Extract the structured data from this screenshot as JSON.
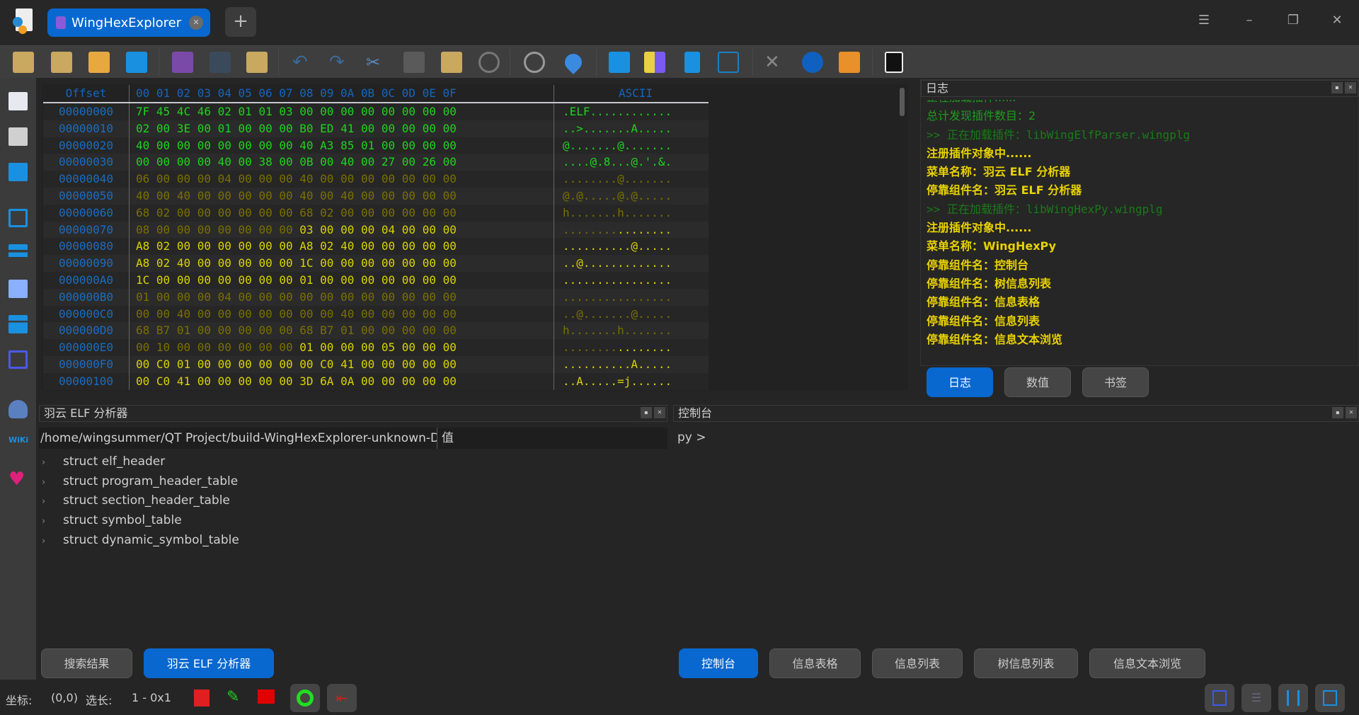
{
  "window": {
    "tab_title": "WingHexExplorer",
    "new_tab": "+",
    "menu_icon": "☰",
    "minimize": "–",
    "restore": "❐",
    "close": "✕"
  },
  "hex": {
    "header": {
      "offset": "Offset",
      "columns": "00 01 02 03 04 05 06 07 08 09 0A 0B 0C 0D 0E 0F",
      "ascii": "ASCII"
    },
    "rows": [
      {
        "offset": "00000000",
        "bytes": "7F 45 4C 46 02 01 01 03 00 00 00 00 00 00 00 00",
        "ascii": ".ELF............",
        "colors": [
          "green",
          "green"
        ]
      },
      {
        "offset": "00000010",
        "bytes": "02 00 3E 00 01 00 00 00 B0 ED 41 00 00 00 00 00",
        "ascii": "..>.......A.....",
        "colors": [
          "green",
          "green"
        ]
      },
      {
        "offset": "00000020",
        "bytes": "40 00 00 00 00 00 00 00 40 A3 85 01 00 00 00 00",
        "ascii": "@.......@.......",
        "colors": [
          "green",
          "green"
        ]
      },
      {
        "offset": "00000030",
        "bytes": "00 00 00 00 40 00 38 00 0B 00 40 00 27 00 26 00",
        "ascii": "....@.8...@.'.&.",
        "colors": [
          "green",
          "green"
        ]
      },
      {
        "offset": "00000040",
        "bytes": "06 00 00 00 04 00 00 00 40 00 00 00 00 00 00 00",
        "ascii": "........@.......",
        "colors": [
          "dim",
          "dim"
        ]
      },
      {
        "offset": "00000050",
        "bytes": "40 00 40 00 00 00 00 00 40 00 40 00 00 00 00 00",
        "ascii": "@.@.....@.@.....",
        "colors": [
          "dim",
          "dim"
        ]
      },
      {
        "offset": "00000060",
        "bytes": "68 02 00 00 00 00 00 00 68 02 00 00 00 00 00 00",
        "ascii": "h.......h.......",
        "colors": [
          "dim",
          "dim"
        ]
      },
      {
        "offset": "00000070",
        "bytes": "08 00 00 00 00 00 00 00 03 00 00 00 04 00 00 00",
        "ascii": "................",
        "colors": [
          "dim",
          "yellow"
        ]
      },
      {
        "offset": "00000080",
        "bytes": "A8 02 00 00 00 00 00 00 A8 02 40 00 00 00 00 00",
        "ascii": "..........@.....",
        "colors": [
          "yellow",
          "yellow"
        ]
      },
      {
        "offset": "00000090",
        "bytes": "A8 02 40 00 00 00 00 00 1C 00 00 00 00 00 00 00",
        "ascii": "..@.............",
        "colors": [
          "yellow",
          "yellow"
        ]
      },
      {
        "offset": "000000A0",
        "bytes": "1C 00 00 00 00 00 00 00 01 00 00 00 00 00 00 00",
        "ascii": "................",
        "colors": [
          "yellow",
          "yellow"
        ]
      },
      {
        "offset": "000000B0",
        "bytes": "01 00 00 00 04 00 00 00 00 00 00 00 00 00 00 00",
        "ascii": "................",
        "colors": [
          "dim",
          "dim"
        ]
      },
      {
        "offset": "000000C0",
        "bytes": "00 00 40 00 00 00 00 00 00 00 40 00 00 00 00 00",
        "ascii": "..@.......@.....",
        "colors": [
          "dim",
          "dim"
        ]
      },
      {
        "offset": "000000D0",
        "bytes": "68 B7 01 00 00 00 00 00 68 B7 01 00 00 00 00 00",
        "ascii": "h.......h.......",
        "colors": [
          "dim",
          "dim"
        ]
      },
      {
        "offset": "000000E0",
        "bytes": "00 10 00 00 00 00 00 00 01 00 00 00 05 00 00 00",
        "ascii": "................",
        "colors": [
          "dim",
          "yellow"
        ]
      },
      {
        "offset": "000000F0",
        "bytes": "00 C0 01 00 00 00 00 00 00 C0 41 00 00 00 00 00",
        "ascii": "..........A.....",
        "colors": [
          "yellow",
          "yellow"
        ]
      },
      {
        "offset": "00000100",
        "bytes": "00 C0 41 00 00 00 00 00 3D 6A 0A 00 00 00 00 00",
        "ascii": "..A.....=j......",
        "colors": [
          "yellow",
          "yellow"
        ]
      }
    ]
  },
  "log": {
    "title": "日志",
    "lines": [
      {
        "text": "正在加载插件......",
        "style": "lg1"
      },
      {
        "text": "总计发现插件数目：2",
        "style": "lg1"
      },
      {
        "text": ">> 正在加载插件：libWingElfParser.wingplg",
        "style": "lg2"
      },
      {
        "text": "注册插件对象中......",
        "style": "lgy"
      },
      {
        "text": "菜单名称：羽云 ELF 分析器",
        "style": "lgy"
      },
      {
        "text": "停靠组件名：羽云 ELF 分析器",
        "style": "lgy"
      },
      {
        "text": ">> 正在加载插件：libWingHexPy.wingplg",
        "style": "lg2"
      },
      {
        "text": "注册插件对象中......",
        "style": "lgy"
      },
      {
        "text": "菜单名称：WingHexPy",
        "style": "lgy"
      },
      {
        "text": "停靠组件名：控制台",
        "style": "lgy"
      },
      {
        "text": "停靠组件名：树信息列表",
        "style": "lgy"
      },
      {
        "text": "停靠组件名：信息表格",
        "style": "lgy"
      },
      {
        "text": "停靠组件名：信息列表",
        "style": "lgy"
      },
      {
        "text": "停靠组件名：信息文本浏览",
        "style": "lgy"
      }
    ],
    "tabs": [
      "日志",
      "数值",
      "书签"
    ]
  },
  "elf": {
    "title": "羽云 ELF 分析器",
    "header": {
      "path": "/home/wingsummer/QT Project/build-WingHexExplorer-unknown-Debug",
      "value": "值"
    },
    "items": [
      "struct elf_header",
      "struct program_header_table",
      "struct section_header_table",
      "struct symbol_table",
      "struct dynamic_symbol_table"
    ]
  },
  "console": {
    "title": "控制台",
    "prompt": "py >"
  },
  "bottom_tabs_left": [
    "搜索结果",
    "羽云 ELF 分析器"
  ],
  "bottom_tabs_right": [
    "控制台",
    "信息表格",
    "信息列表",
    "树信息列表",
    "信息文本浏览"
  ],
  "status": {
    "coord_label": "坐标:",
    "coord_value": "(0,0)",
    "sel_label": "选长:",
    "sel_value": "1 - 0x1"
  },
  "colors": {
    "accent": "#0868cf",
    "hex_green": "#1fd31f",
    "hex_yellow": "#d8d400",
    "hex_dim": "#7a7000",
    "offset_blue": "#1a6cc0"
  }
}
